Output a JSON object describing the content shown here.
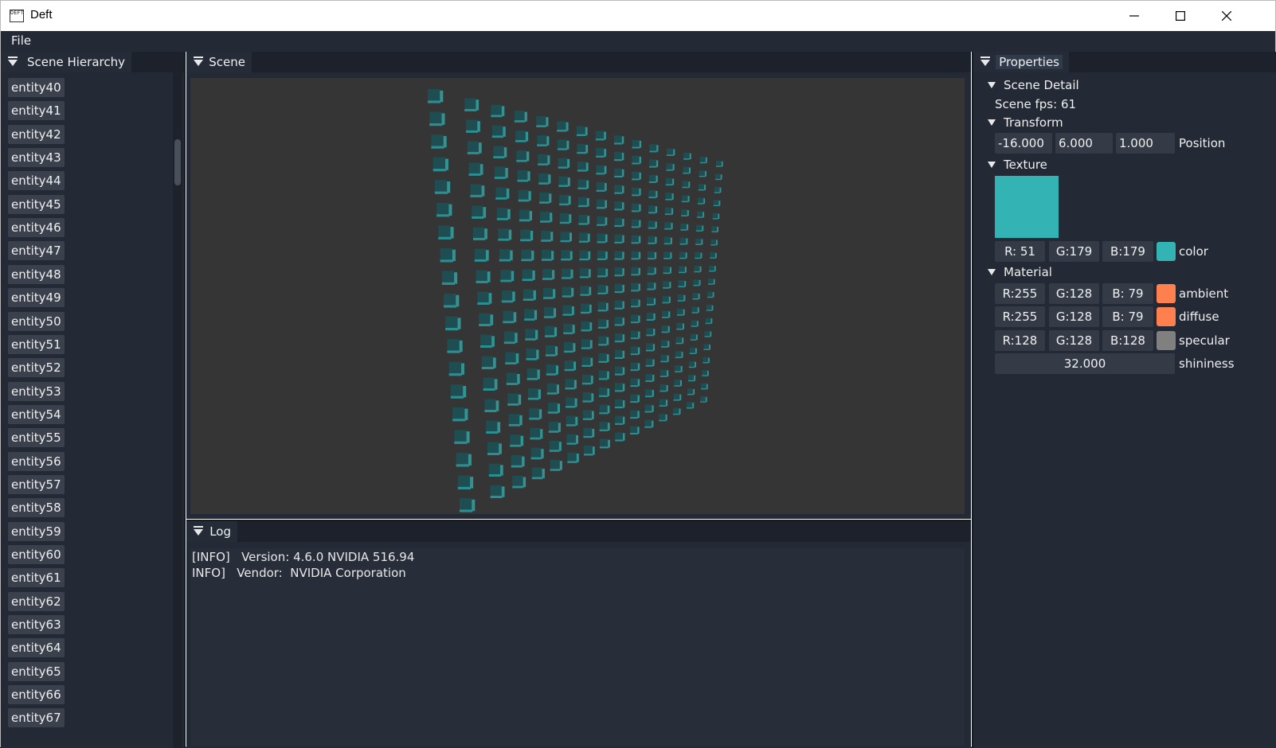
{
  "window": {
    "title": "Deft",
    "icon_text": "DEFT",
    "controls": {
      "minimize_icon": "minimize-icon",
      "maximize_icon": "maximize-icon",
      "close_icon": "close-icon"
    }
  },
  "menu": {
    "items": [
      "File"
    ]
  },
  "hierarchy": {
    "title": "Scene Hierarchy",
    "entities": [
      "entity40",
      "entity41",
      "entity42",
      "entity43",
      "entity44",
      "entity45",
      "entity46",
      "entity47",
      "entity48",
      "entity49",
      "entity50",
      "entity51",
      "entity52",
      "entity53",
      "entity54",
      "entity55",
      "entity56",
      "entity57",
      "entity58",
      "entity59",
      "entity60",
      "entity61",
      "entity62",
      "entity63",
      "entity64",
      "entity65",
      "entity66",
      "entity67"
    ]
  },
  "scene": {
    "title": "Scene",
    "grid_cols": 15,
    "grid_rows": 19,
    "cube_color": "#33b3b3",
    "background": "#353535"
  },
  "log": {
    "title": "Log",
    "lines": [
      "[INFO]   Version: 4.6.0 NVIDIA 516.94",
      "INFO]   Vendor:  NVIDIA Corporation"
    ]
  },
  "properties": {
    "title": "Properties",
    "scene_detail": {
      "label": "Scene Detail",
      "fps": "Scene fps: 61"
    },
    "transform": {
      "label": "Transform",
      "x": "-16.000",
      "y": "6.000",
      "z": "1.000",
      "position_label": "Position"
    },
    "texture": {
      "label": "Texture",
      "preview_color": "#33b3b3",
      "r": "R: 51",
      "g": "G:179",
      "b": "B:179",
      "swatch_color": "#33b3b3",
      "color_label": "color"
    },
    "material": {
      "label": "Material",
      "ambient": {
        "r": "R:255",
        "g": "G:128",
        "b": "B: 79",
        "color": "#ff804f",
        "label": "ambient"
      },
      "diffuse": {
        "r": "R:255",
        "g": "G:128",
        "b": "B: 79",
        "color": "#ff804f",
        "label": "diffuse"
      },
      "specular": {
        "r": "R:128",
        "g": "G:128",
        "b": "B:128",
        "color": "#808080",
        "label": "specular"
      },
      "shininess": {
        "value": "32.000",
        "label": "shininess"
      }
    }
  }
}
